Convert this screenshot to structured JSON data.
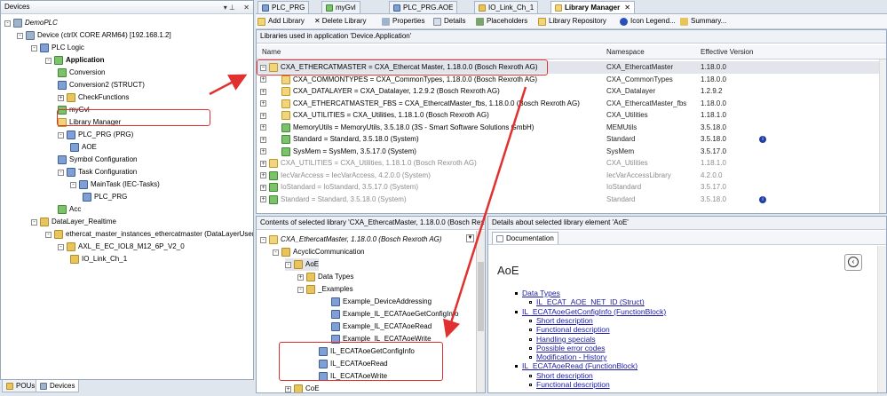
{
  "devices_panel": {
    "title": "Devices",
    "tree": [
      {
        "label": "DemoPLC",
        "italic": true
      },
      {
        "label": "Device (ctrlX CORE ARM64) [192.168.1.2]"
      },
      {
        "label": "PLC Logic"
      },
      {
        "label": "Application",
        "bold": true
      },
      {
        "label": "Conversion"
      },
      {
        "label": "Conversion2 (STRUCT)"
      },
      {
        "label": "CheckFunctions"
      },
      {
        "label": "myGvl"
      },
      {
        "label": "Library Manager"
      },
      {
        "label": "PLC_PRG (PRG)"
      },
      {
        "label": "AOE"
      },
      {
        "label": "Symbol Configuration"
      },
      {
        "label": "Task Configuration"
      },
      {
        "label": "MainTask (IEC-Tasks)"
      },
      {
        "label": "PLC_PRG"
      },
      {
        "label": "Acc"
      },
      {
        "label": "DataLayer_Realtime"
      },
      {
        "label": "ethercat_master_instances_ethercatmaster (DataLayerUser)"
      },
      {
        "label": "AXL_E_EC_IOL8_M12_6P_V2_0"
      },
      {
        "label": "IO_Link_Ch_1"
      }
    ],
    "bottom_tabs": [
      "POUs",
      "Devices"
    ]
  },
  "editor_tabs": [
    "PLC_PRG",
    "myGvl",
    "PLC_PRG.AOE",
    "IO_Link_Ch_1",
    "Library Manager"
  ],
  "toolbar": {
    "add_library": "Add Library",
    "delete_library": "Delete Library",
    "properties": "Properties",
    "details": "Details",
    "placeholders": "Placeholders",
    "library_repository": "Library Repository",
    "icon_legend": "Icon Legend...",
    "summary": "Summary..."
  },
  "libs_header": "Libraries used in application 'Device.Application'",
  "libs_columns": [
    "Name",
    "Namespace",
    "Effective Version"
  ],
  "libraries": [
    {
      "name": "CXA_ETHERCATMASTER = CXA_Ethercat Master, 1.18.0.0 (Bosch Rexroth AG)",
      "ns": "CXA_EthercatMaster",
      "ver": "1.18.0.0",
      "icon": "lib",
      "grey": false,
      "sel": true
    },
    {
      "name": "CXA_COMMONTYPES = CXA_CommonTypes, 1.18.0.0 (Bosch Rexroth AG)",
      "ns": "CXA_CommonTypes",
      "ver": "1.18.0.0",
      "icon": "lib",
      "grey": false
    },
    {
      "name": "CXA_DATALAYER = CXA_Datalayer, 1.2.9.2 (Bosch Rexroth AG)",
      "ns": "CXA_Datalayer",
      "ver": "1.2.9.2",
      "icon": "lib",
      "grey": false
    },
    {
      "name": "CXA_ETHERCATMASTER_FBS = CXA_EthercatMaster_fbs, 1.18.0.0 (Bosch Rexroth AG)",
      "ns": "CXA_EthercatMaster_fbs",
      "ver": "1.18.0.0",
      "icon": "lib",
      "grey": false
    },
    {
      "name": "CXA_UTILITIES = CXA_Utilities, 1.18.1.0 (Bosch Rexroth AG)",
      "ns": "CXA_Utilities",
      "ver": "1.18.1.0",
      "icon": "lib",
      "grey": false
    },
    {
      "name": "MemoryUtils = MemoryUtils, 3.5.18.0 (3S - Smart Software Solutions GmbH)",
      "ns": "MEMUtils",
      "ver": "3.5.18.0",
      "icon": "gr",
      "grey": false
    },
    {
      "name": "Standard = Standard, 3.5.18.0 (System)",
      "ns": "Standard",
      "ver": "3.5.18.0",
      "icon": "gr",
      "grey": false,
      "info": true
    },
    {
      "name": "SysMem = SysMem, 3.5.17.0 (System)",
      "ns": "SysMem",
      "ver": "3.5.17.0",
      "icon": "gr",
      "grey": false
    },
    {
      "name": "CXA_UTILITIES = CXA_Utilities, 1.18.1.0 (Bosch Rexroth AG)",
      "ns": "CXA_Utilities",
      "ver": "1.18.1.0",
      "icon": "lib",
      "grey": true
    },
    {
      "name": "IecVarAccess = IecVarAccess, 4.2.0.0 (System)",
      "ns": "IecVarAccessLibrary",
      "ver": "4.2.0.0",
      "icon": "gr",
      "grey": true
    },
    {
      "name": "IoStandard = IoStandard, 3.5.17.0 (System)",
      "ns": "IoStandard",
      "ver": "3.5.17.0",
      "icon": "gr",
      "grey": true
    },
    {
      "name": "Standard = Standard, 3.5.18.0 (System)",
      "ns": "Standard",
      "ver": "3.5.18.0",
      "icon": "gr",
      "grey": true,
      "info": true
    }
  ],
  "contents_header": "Contents of selected library 'CXA_EthercatMaster, 1.18.0.0 (Bosch Rex",
  "contents_tree": [
    {
      "label": "CXA_EthercatMaster, 1.18.0.0 (Bosch Rexroth AG)",
      "italic": true
    },
    {
      "label": "AcyclicCommunication"
    },
    {
      "label": "AoE"
    },
    {
      "label": "Data Types"
    },
    {
      "label": "_Examples"
    },
    {
      "label": "Example_DeviceAddressing"
    },
    {
      "label": "Example_IL_ECATAoeGetConfigInfo"
    },
    {
      "label": "Example_IL_ECATAoeRead"
    },
    {
      "label": "Example_IL_ECATAoeWrite"
    },
    {
      "label": "IL_ECATAoeGetConfigInfo"
    },
    {
      "label": "IL_ECATAoeRead"
    },
    {
      "label": "IL_ECATAoeWrite"
    },
    {
      "label": "CoE"
    }
  ],
  "details_header": "Details about selected library element 'AoE'",
  "details_tab": "Documentation",
  "doc": {
    "title": "AoE",
    "items": [
      {
        "text": "Data Types",
        "level": 1
      },
      {
        "text": "IL_ECAT_AOE_NET_ID (Struct)",
        "level": 2
      },
      {
        "text": "IL_ECATAoeGetConfigInfo (FunctionBlock)",
        "level": 1
      },
      {
        "text": "Short description",
        "level": 2
      },
      {
        "text": "Functional description",
        "level": 2
      },
      {
        "text": "Handling specials",
        "level": 2
      },
      {
        "text": "Possible error codes",
        "level": 2
      },
      {
        "text": "Modification - History",
        "level": 2
      },
      {
        "text": "IL_ECATAoeRead (FunctionBlock)",
        "level": 1
      },
      {
        "text": "Short description",
        "level": 2
      },
      {
        "text": "Functional description",
        "level": 2
      }
    ]
  },
  "colors": {
    "highlight_red": "#e0302f",
    "arrow_red": "#e0302f",
    "selection": "#e2e6ec"
  }
}
